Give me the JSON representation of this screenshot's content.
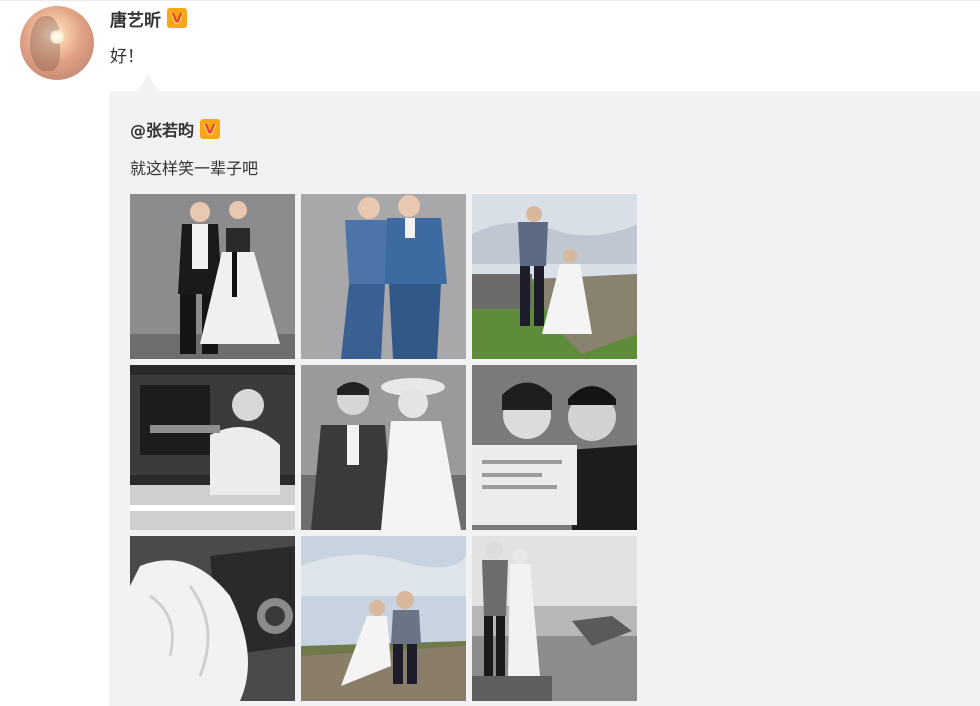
{
  "post": {
    "user_name": "唐艺昕",
    "verified_badge_icon": "verified-v-badge-icon",
    "text": "好！"
  },
  "quoted_post": {
    "user_name": "@张若昀",
    "verified_badge_icon": "verified-v-badge-icon",
    "text": "就这样笑一辈子吧"
  },
  "photos": [
    {
      "name": "photo-1",
      "desc": "couple standing, studio grey backdrop"
    },
    {
      "name": "photo-2",
      "desc": "couple in denim outfits"
    },
    {
      "name": "photo-3",
      "desc": "couple on grassy cliff by ruins"
    },
    {
      "name": "photo-4",
      "desc": "black and white in vintage car"
    },
    {
      "name": "photo-5",
      "desc": "black and white smiling couple, hat"
    },
    {
      "name": "photo-6",
      "desc": "black and white reading newspaper"
    },
    {
      "name": "photo-7",
      "desc": "black and white tulle dress by car"
    },
    {
      "name": "photo-8",
      "desc": "couple sitting on stone wall"
    },
    {
      "name": "photo-9",
      "desc": "black and white couple on coast"
    }
  ],
  "colors": {
    "badge_bg": "#f7a616",
    "badge_fg": "#e8432d",
    "quote_bg": "#f2f2f5",
    "text": "#333333"
  }
}
